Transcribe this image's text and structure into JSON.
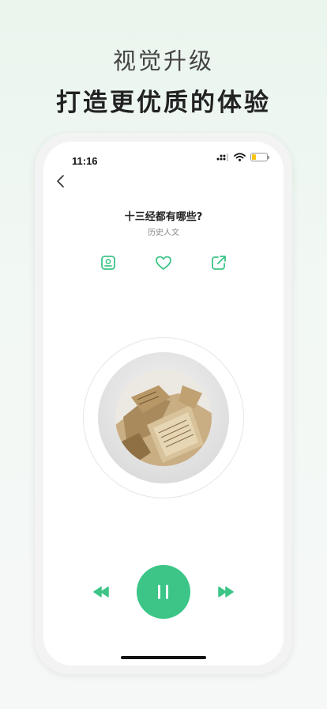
{
  "promo": {
    "subtitle": "视觉升级",
    "title": "打造更优质的体验"
  },
  "status_bar": {
    "time": "11:16"
  },
  "player": {
    "title": "十三经都有哪些?",
    "category": "历史人文"
  },
  "icons": {
    "back": "chevron-left-icon",
    "cover": "image-icon",
    "favorite": "heart-icon",
    "share": "share-icon",
    "rewind": "rewind-icon",
    "pause": "pause-icon",
    "forward": "fast-forward-icon"
  },
  "colors": {
    "accent": "#3cc587",
    "battery": "#f5c518"
  }
}
